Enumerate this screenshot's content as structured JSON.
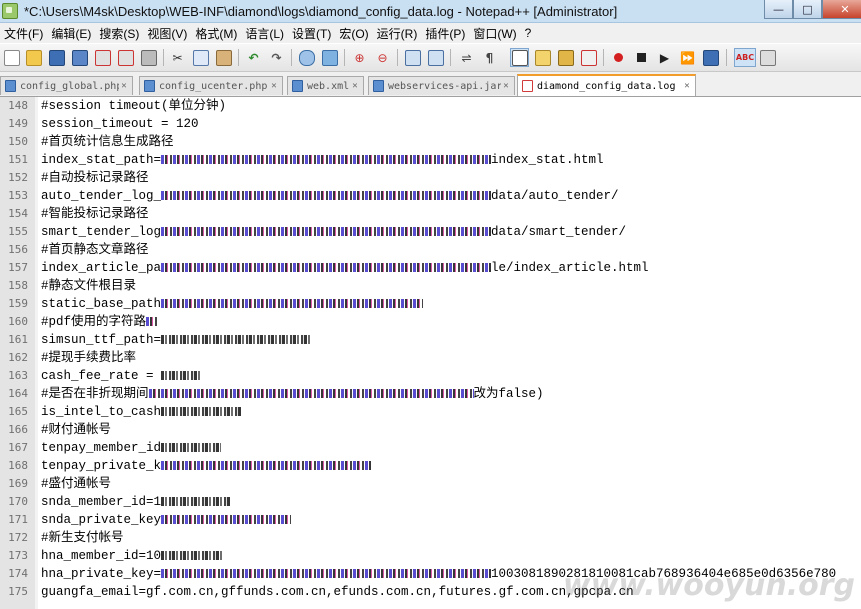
{
  "window": {
    "title": "*C:\\Users\\M4sk\\Desktop\\WEB-INF\\diamond\\logs\\diamond_config_data.log - Notepad++ [Administrator]",
    "minimize": "—",
    "maximize": "□",
    "close": "✕"
  },
  "menu": [
    "文件(F)",
    "编辑(E)",
    "搜索(S)",
    "视图(V)",
    "格式(M)",
    "语言(L)",
    "设置(T)",
    "宏(O)",
    "运行(R)",
    "插件(P)",
    "窗口(W)",
    "?"
  ],
  "tabs": [
    {
      "label": "config_global.php",
      "close": "✕",
      "icon": "blue"
    },
    {
      "label": "config_ucenter.php",
      "close": "✕",
      "icon": "blue"
    },
    {
      "label": "web.xml",
      "close": "✕",
      "icon": "blue"
    },
    {
      "label": "webservices-api.jar",
      "close": "✕",
      "icon": "blue"
    },
    {
      "label": "diamond_config_data.log",
      "close": "✕",
      "icon": "red"
    }
  ],
  "lines": [
    {
      "n": "148",
      "text": "#session timeout(单位分钟)"
    },
    {
      "n": "149",
      "text": "session_timeout = 120"
    },
    {
      "n": "150",
      "text": "#首页统计信息生成路径"
    },
    {
      "n": "151",
      "text": "index_stat_path=",
      "tail": "index_stat.html"
    },
    {
      "n": "152",
      "text": "#自动投标记录路径"
    },
    {
      "n": "153",
      "text": "auto_tender_log_",
      "tail": "data/auto_tender/"
    },
    {
      "n": "154",
      "text": "#智能投标记录路径"
    },
    {
      "n": "155",
      "text": "smart_tender_log",
      "tail": "data/smart_tender/"
    },
    {
      "n": "156",
      "text": "#首页静态文章路径"
    },
    {
      "n": "157",
      "text": "index_article_pa",
      "tail": "le/index_article.html"
    },
    {
      "n": "158",
      "text": "#静态文件根目录"
    },
    {
      "n": "159",
      "text": "static_base_path",
      "tail": ""
    },
    {
      "n": "160",
      "text": "#pdf使用的字符路",
      "tail": ""
    },
    {
      "n": "161",
      "text": "simsun_ttf_path=",
      "tail": ""
    },
    {
      "n": "162",
      "text": "#提现手续费比率"
    },
    {
      "n": "163",
      "text": "cash_fee_rate = ",
      "tail": ""
    },
    {
      "n": "164",
      "text": "#是否在非折现期间",
      "tail": "改为false)"
    },
    {
      "n": "165",
      "text": "is_intel_to_cash",
      "tail": ""
    },
    {
      "n": "166",
      "text": "#财付通帐号"
    },
    {
      "n": "167",
      "text": "tenpay_member_id",
      "tail": ""
    },
    {
      "n": "168",
      "text": "tenpay_private_k",
      "tail": ""
    },
    {
      "n": "169",
      "text": "#盛付通帐号"
    },
    {
      "n": "170",
      "text": "snda_member_id=1",
      "tail": ""
    },
    {
      "n": "171",
      "text": "snda_private_key",
      "tail": ""
    },
    {
      "n": "172",
      "text": "#新生支付帐号"
    },
    {
      "n": "173",
      "text": "hna_member_id=10",
      "tail": ""
    },
    {
      "n": "174",
      "text": "hna_private_key=",
      "tail": "1003081890281810081cab768936404e685e0d6356e780"
    },
    {
      "n": "175",
      "text": "guangfa_email=gf.com.cn,gffunds.com.cn,efunds.com.cn,futures.gf.com.cn,gpcpa.cn"
    }
  ],
  "watermark": "www.wooyun.org"
}
